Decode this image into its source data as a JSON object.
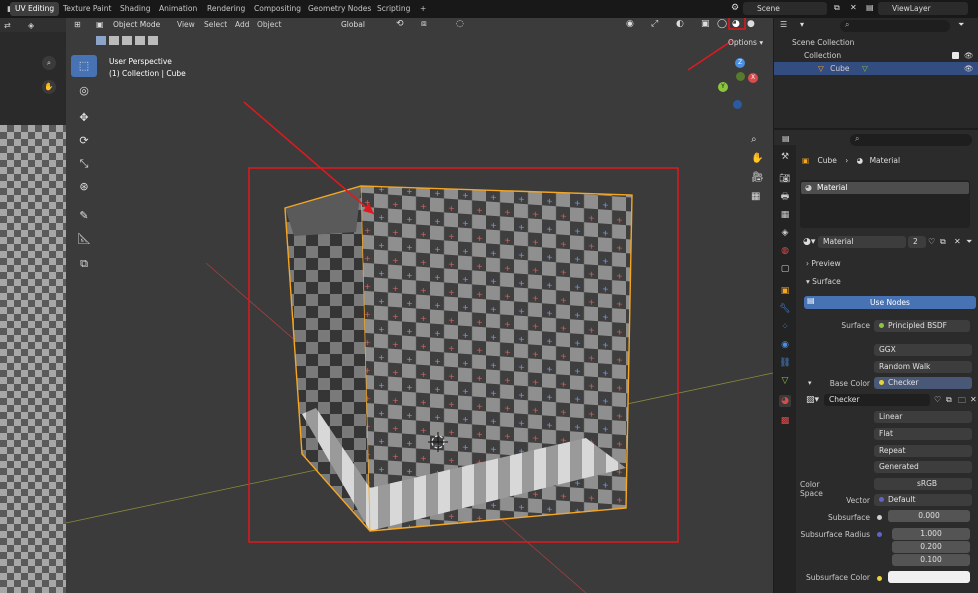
{
  "top_tabs": [
    "UV Editing",
    "Texture Paint",
    "Shading",
    "Animation",
    "Rendering",
    "Compositing",
    "Geometry Nodes",
    "Scripting",
    "+"
  ],
  "active_tab": "UV Editing",
  "scene": {
    "label": "Scene"
  },
  "viewlayer": {
    "label": "ViewLayer"
  },
  "viewport": {
    "mode": "Object Mode",
    "menus": [
      "View",
      "Select",
      "Add",
      "Object"
    ],
    "transform": "Global",
    "overlay_title": "User Perspective",
    "overlay_sub": "(1) Collection | Cube",
    "options": "Options"
  },
  "gizmo": {
    "x": "X",
    "y": "Y",
    "z": "Z"
  },
  "outliner": {
    "scene_collection": "Scene Collection",
    "collection": "Collection",
    "cube": "Cube"
  },
  "properties": {
    "breadcrumb_object": "Cube",
    "breadcrumb_material": "Material",
    "slot": "Material",
    "material_name": "Material",
    "users": "2",
    "preview": "Preview",
    "surface_section": "Surface",
    "use_nodes": "Use Nodes",
    "rows": {
      "surface_label": "Surface",
      "surface_value": "Principled BSDF",
      "distribution": "GGX",
      "subsurface_method": "Random Walk",
      "base_color_label": "Base Color",
      "base_color_value": "Checker",
      "image_name": "Checker",
      "interpolation": "Linear",
      "projection": "Flat",
      "extension": "Repeat",
      "source": "Generated",
      "color_space_label": "Color Space",
      "color_space_value": "sRGB",
      "vector_label": "Vector",
      "vector_value": "Default",
      "subsurface_label": "Subsurface",
      "subsurface_value": "0.000",
      "radius_label": "Subsurface Radius",
      "radius": [
        "1.000",
        "0.200",
        "0.100"
      ],
      "subsurface_color_label": "Subsurface Color"
    }
  },
  "colors": {
    "accent_blue": "#4772b3",
    "annotation_red": "#e0191e",
    "selection_orange": "#f5a623",
    "axis_red": "#d84c4c",
    "axis_green": "#8cc63f",
    "axis_blue": "#4a8fe0"
  }
}
